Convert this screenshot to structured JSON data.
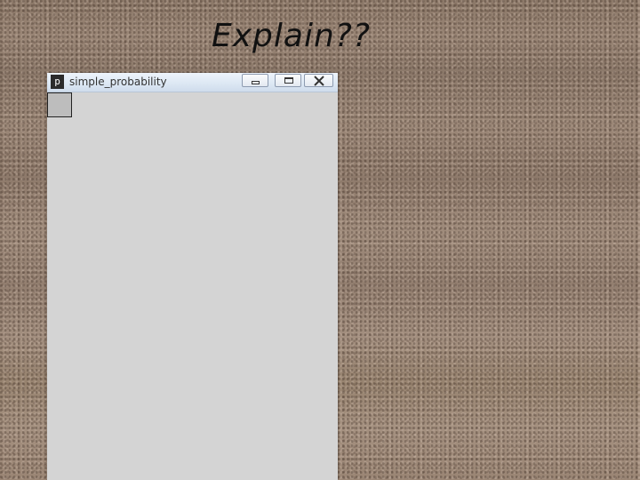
{
  "slide": {
    "title": "Explain??"
  },
  "window": {
    "title": "simple_probability",
    "icon": "processing-p-icon",
    "icon_glyph": "p",
    "buttons": {
      "minimize": "minimize-icon",
      "maximize": "maximize-icon",
      "close": "close-icon"
    }
  },
  "colors": {
    "canvas_background": "#d4d4d4",
    "square_fill": "#bdbdbd",
    "square_stroke": "#222222"
  }
}
